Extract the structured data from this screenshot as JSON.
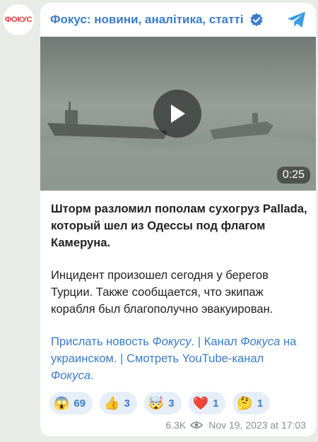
{
  "avatar": {
    "label": "ФОКУС"
  },
  "header": {
    "title": "Фокус: новини, аналітика, статті",
    "verified_icon": "verified-badge-icon",
    "telegram_icon": "telegram-plane-icon"
  },
  "video": {
    "duration": "0:25",
    "play_icon": "play-icon"
  },
  "post": {
    "bold": "Шторм разломил пополам сухогруз Pallada, который шел из Одессы под флагом Камеруна.",
    "body": "Инцидент произошел сегодня у берегов Турции. Также сообщается, что экипаж корабля был благополучно эвакуирован.",
    "links": {
      "l1": "Прислать новость",
      "l1_italic": "Фокусу",
      "sep1": ". | Канал",
      "l2_italic": "Фокуса",
      "l2": "на украинском",
      "sep2": ". | Смотреть YouTube-канал",
      "l3_italic": "Фокуса",
      "end": "."
    }
  },
  "reactions": [
    {
      "emoji": "😱",
      "count": "69"
    },
    {
      "emoji": "👍",
      "count": "3"
    },
    {
      "emoji": "🤯",
      "count": "3"
    },
    {
      "emoji": "❤️",
      "count": "1"
    },
    {
      "emoji": "🤔",
      "count": "1"
    }
  ],
  "meta": {
    "views": "6.3K",
    "eye_icon": "eye-icon",
    "date": "Nov 19, 2023 at 17:03"
  },
  "colors": {
    "accent": "#3a7dc9",
    "background": "#e8ebe6",
    "logo_red": "#e53935"
  }
}
